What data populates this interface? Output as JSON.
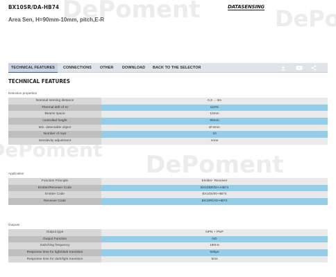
{
  "header": {
    "product_code": "BX10SR/DA-HB74",
    "brand": "DATASENSING",
    "subtitle": "Area Sen, H=90mm-10mm, pitch,E-R"
  },
  "watermark": "DePoment",
  "tabs": [
    {
      "label": "TECHNICAL FEATURES",
      "active": true
    },
    {
      "label": "CONNECTIONS",
      "active": false
    },
    {
      "label": "OTHER",
      "active": false
    },
    {
      "label": "DOWNLOAD",
      "active": false
    },
    {
      "label": "BACK TO THE SELECTOR",
      "active": false
    }
  ],
  "tab_icons": [
    "download-icon",
    "video-icon",
    "share-icon"
  ],
  "section_title": "TECHNICAL FEATURES",
  "groups": {
    "detection": {
      "label": "Detection properties",
      "rows": [
        {
          "label": "Nominal sensing distance",
          "value": "0,3 ... 3m"
        },
        {
          "label": "Thermal drift of Sr",
          "value": "≤10%"
        },
        {
          "label": "Beams space",
          "value": "10mm"
        },
        {
          "label": "controlled height",
          "value": "90mm"
        },
        {
          "label": "Min. detectable object",
          "value": "Ø 5mm"
        },
        {
          "label": "Number of rays",
          "value": "10"
        },
        {
          "label": "Sensitivity adjustment",
          "value": "none"
        }
      ]
    },
    "application": {
      "label": "Application",
      "rows": [
        {
          "label": "Function Principle",
          "value": "Emitter- Receiver"
        },
        {
          "label": "Emitter/Receiver Code",
          "value": "BX10DR/DA-HB74"
        },
        {
          "label": "Emitter Code",
          "value": "BX10S/00-HB74"
        },
        {
          "label": "Receiver Code",
          "value": "BX10R/AD-HB74"
        }
      ]
    },
    "outputs": {
      "label": "Outputs",
      "rows": [
        {
          "label": "Output type",
          "value": "NPN + PNP"
        },
        {
          "label": "Output Function",
          "value": "NO"
        },
        {
          "label": "Switching frequency",
          "value": "180Hz"
        },
        {
          "label": "Response time for light/dark transition",
          "value": "500µs"
        },
        {
          "label": "Response time for dark/light transition",
          "value": "5ms"
        }
      ]
    }
  }
}
